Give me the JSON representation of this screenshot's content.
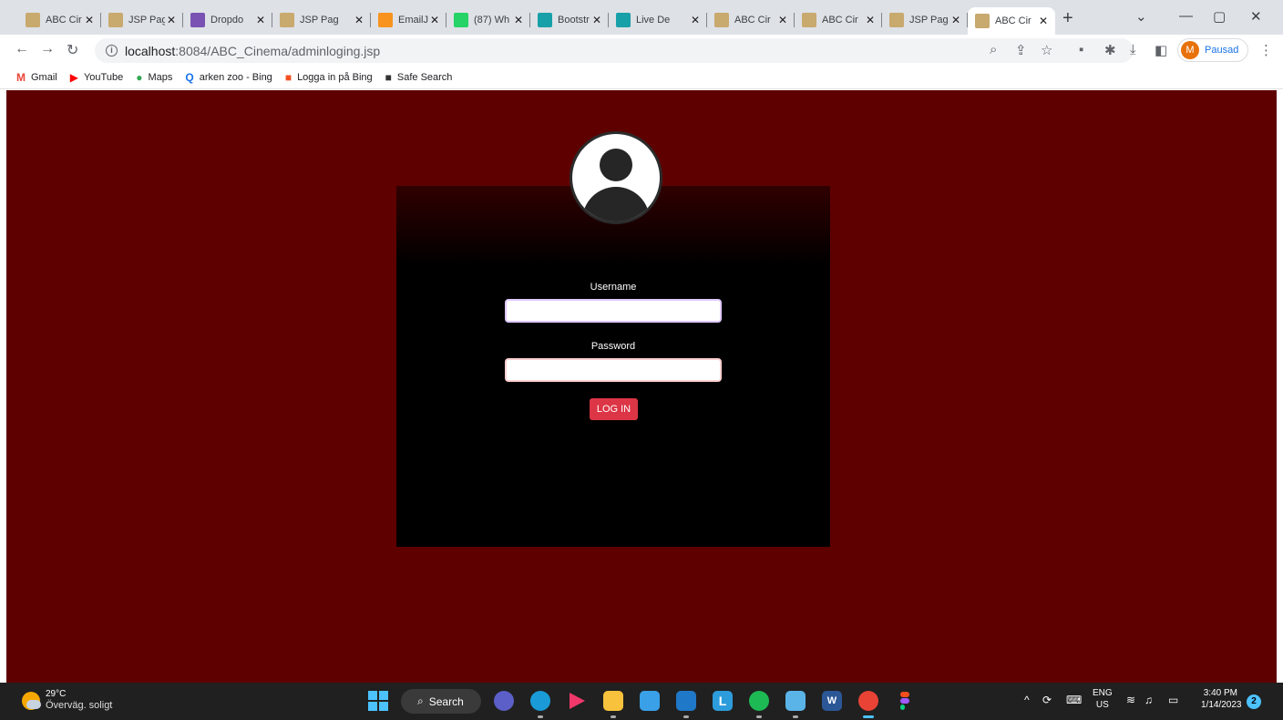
{
  "browser": {
    "tabs": [
      {
        "title": "ABC Cir",
        "favicon": "image-icon",
        "color": "#c8a96e"
      },
      {
        "title": "JSP Pag",
        "favicon": "image-icon",
        "color": "#c8a96e"
      },
      {
        "title": "Dropdo",
        "favicon": "bootstrap-icon",
        "color": "#7952b3"
      },
      {
        "title": "JSP Pag",
        "favicon": "image-icon",
        "color": "#c8a96e"
      },
      {
        "title": "EmailJS",
        "favicon": "emailjs-icon",
        "color": "#f7931e"
      },
      {
        "title": "(87) Wh",
        "favicon": "whatsapp-icon",
        "color": "#25d366"
      },
      {
        "title": "Bootstr",
        "favicon": "bootstrap-made-icon",
        "color": "#18a0a8"
      },
      {
        "title": "Live De",
        "favicon": "live-demo-icon",
        "color": "#18a0a8"
      },
      {
        "title": "ABC Cir",
        "favicon": "image-icon",
        "color": "#c8a96e"
      },
      {
        "title": "ABC Cir",
        "favicon": "image-icon",
        "color": "#c8a96e"
      },
      {
        "title": "JSP Pag",
        "favicon": "image-icon",
        "color": "#c8a96e"
      },
      {
        "title": "ABC Cir",
        "favicon": "image-icon",
        "color": "#c8a96e",
        "active": true
      }
    ],
    "url_host": "localhost",
    "url_path": ":8084/ABC_Cinema/adminloging.jsp",
    "profile_initial": "M",
    "profile_label": "Pausad"
  },
  "bookmarks": [
    {
      "label": "Gmail",
      "icon": "gmail-icon",
      "glyph": "M",
      "color": "#ea4335"
    },
    {
      "label": "YouTube",
      "icon": "youtube-icon",
      "glyph": "▶",
      "color": "#ff0000"
    },
    {
      "label": "Maps",
      "icon": "maps-icon",
      "glyph": "●",
      "color": "#34a853"
    },
    {
      "label": "arken zoo - Bing",
      "icon": "bing-search-icon",
      "glyph": "Q",
      "color": "#1a73e8"
    },
    {
      "label": "Logga in på Bing",
      "icon": "microsoft-icon",
      "glyph": "■",
      "color": "#f25022"
    },
    {
      "label": "Safe Search",
      "icon": "safe-search-icon",
      "glyph": "■",
      "color": "#333333"
    }
  ],
  "login": {
    "username_label": "Username",
    "username_value": "",
    "password_label": "Password",
    "password_value": "",
    "button_label": "LOG IN"
  },
  "colors": {
    "page_background": "#5e0000",
    "card_background": "#000000",
    "button": "#dc3545"
  },
  "taskbar": {
    "weather_temp": "29°C",
    "weather_text": "Överväg. soligt",
    "search_label": "Search",
    "lang_top": "ENG",
    "lang_bottom": "US",
    "time": "3:40 PM",
    "date": "1/14/2023",
    "notifications": "2"
  }
}
